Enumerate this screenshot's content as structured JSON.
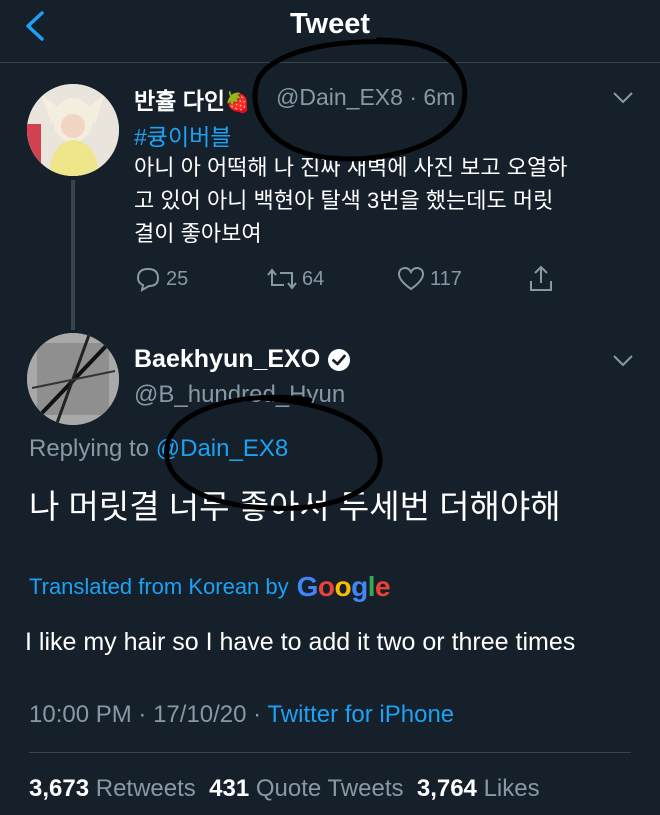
{
  "header": {
    "title": "Tweet"
  },
  "original": {
    "name": "반휼 다인",
    "name_emoji": "🍓",
    "handle": "@Dain_EX8",
    "dot": "·",
    "time": "6m",
    "hashtag": "#큥이버블",
    "text": "아니 아 어떡해 나 진짜 새벽에 사진 보고 오열하\n고 있어 아니 백현아 탈색 3번을 했는데도 머릿\n결이 좋아보여",
    "replies": "25",
    "retweets": "64",
    "likes": "117"
  },
  "reply": {
    "name": "Baekhyun_EXO",
    "handle": "@B_hundred_Hyun",
    "replying_prefix": "Replying to",
    "replying_to": "@Dain_EX8",
    "text": "나 머릿결 너무 좋아서 두세번 더해야해",
    "translated_label": "Translated from Korean by",
    "google": [
      "G",
      "o",
      "o",
      "g",
      "l",
      "e"
    ],
    "translation": "I like my hair so I have to add it two or three times",
    "time": "10:00 PM",
    "date": "17/10/20",
    "meta_sep": "·",
    "source": "Twitter for iPhone",
    "retweets_count": "3,673",
    "retweets_label": "Retweets",
    "quote_count": "431",
    "quote_label": "Quote Tweets",
    "likes_count": "3,764",
    "likes_label": "Likes"
  },
  "colors": {
    "background": "#15202b",
    "accent": "#1da1f2",
    "muted": "#8899a6",
    "divider": "#38444d",
    "verified_badge": "#ffffff"
  },
  "icons": [
    "back-arrow-icon",
    "chevron-down-icon",
    "reply-icon",
    "retweet-icon",
    "like-icon",
    "share-icon",
    "verified-badge-icon"
  ]
}
